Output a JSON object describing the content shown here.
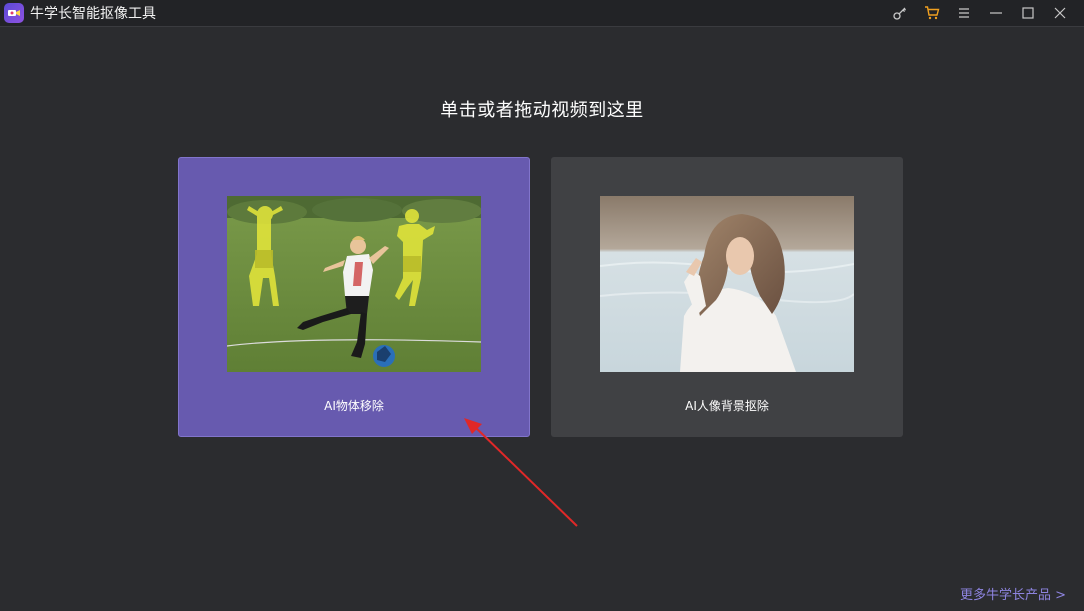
{
  "app": {
    "title": "牛学长智能抠像工具",
    "accent_color": "#675aaf"
  },
  "titlebar": {
    "icons": [
      "key-icon",
      "cart-icon",
      "menu-icon",
      "minimize-icon",
      "maximize-icon",
      "close-icon"
    ],
    "cart_color": "#f0a020"
  },
  "main": {
    "headline": "单击或者拖动视频到这里",
    "cards": [
      {
        "label": "AI物体移除",
        "selected": true
      },
      {
        "label": "AI人像背景抠除",
        "selected": false
      }
    ]
  },
  "footer": {
    "more_link": "更多牛学长产品 >"
  }
}
